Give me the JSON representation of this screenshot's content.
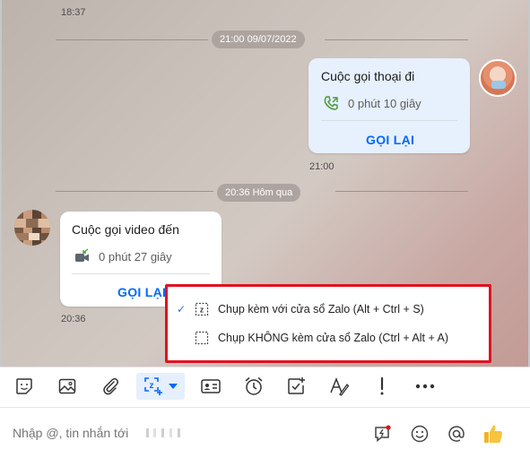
{
  "chat": {
    "top_time": "18:37",
    "date_separator_1": "21:00 09/07/2022",
    "outgoing_call": {
      "title": "Cuộc gọi thoại đi",
      "duration": "0 phút 10 giây",
      "action": "GỌI LẠI",
      "time": "21:00"
    },
    "date_separator_2": "20:36 Hôm qua",
    "incoming_call": {
      "title": "Cuộc gọi video đến",
      "duration": "0 phút 27 giây",
      "action": "GỌI LẠI",
      "time": "20:36"
    }
  },
  "capture_menu": {
    "items": [
      {
        "label": "Chụp kèm với cửa sổ Zalo (Alt + Ctrl + S)",
        "checked": true,
        "icon": "screenshot-with-window-icon"
      },
      {
        "label": "Chụp KHÔNG kèm cửa sổ Zalo (Ctrl + Alt + A)",
        "checked": false,
        "icon": "screenshot-without-window-icon"
      }
    ]
  },
  "toolbar": {
    "buttons": [
      "sticker-icon",
      "image-icon",
      "attachment-icon",
      "screenshot-icon",
      "contact-card-icon",
      "reminder-icon",
      "task-icon",
      "format-text-icon",
      "important-icon",
      "more-icon"
    ],
    "check_mark": "✓"
  },
  "composer": {
    "placeholder": "Nhập @, tin nhắn tới",
    "icons": [
      "quick-message-icon",
      "emoji-icon",
      "mention-icon",
      "thumbs-up-icon"
    ]
  },
  "colors": {
    "accent": "#0068ff",
    "highlight_border": "#e0121f"
  }
}
